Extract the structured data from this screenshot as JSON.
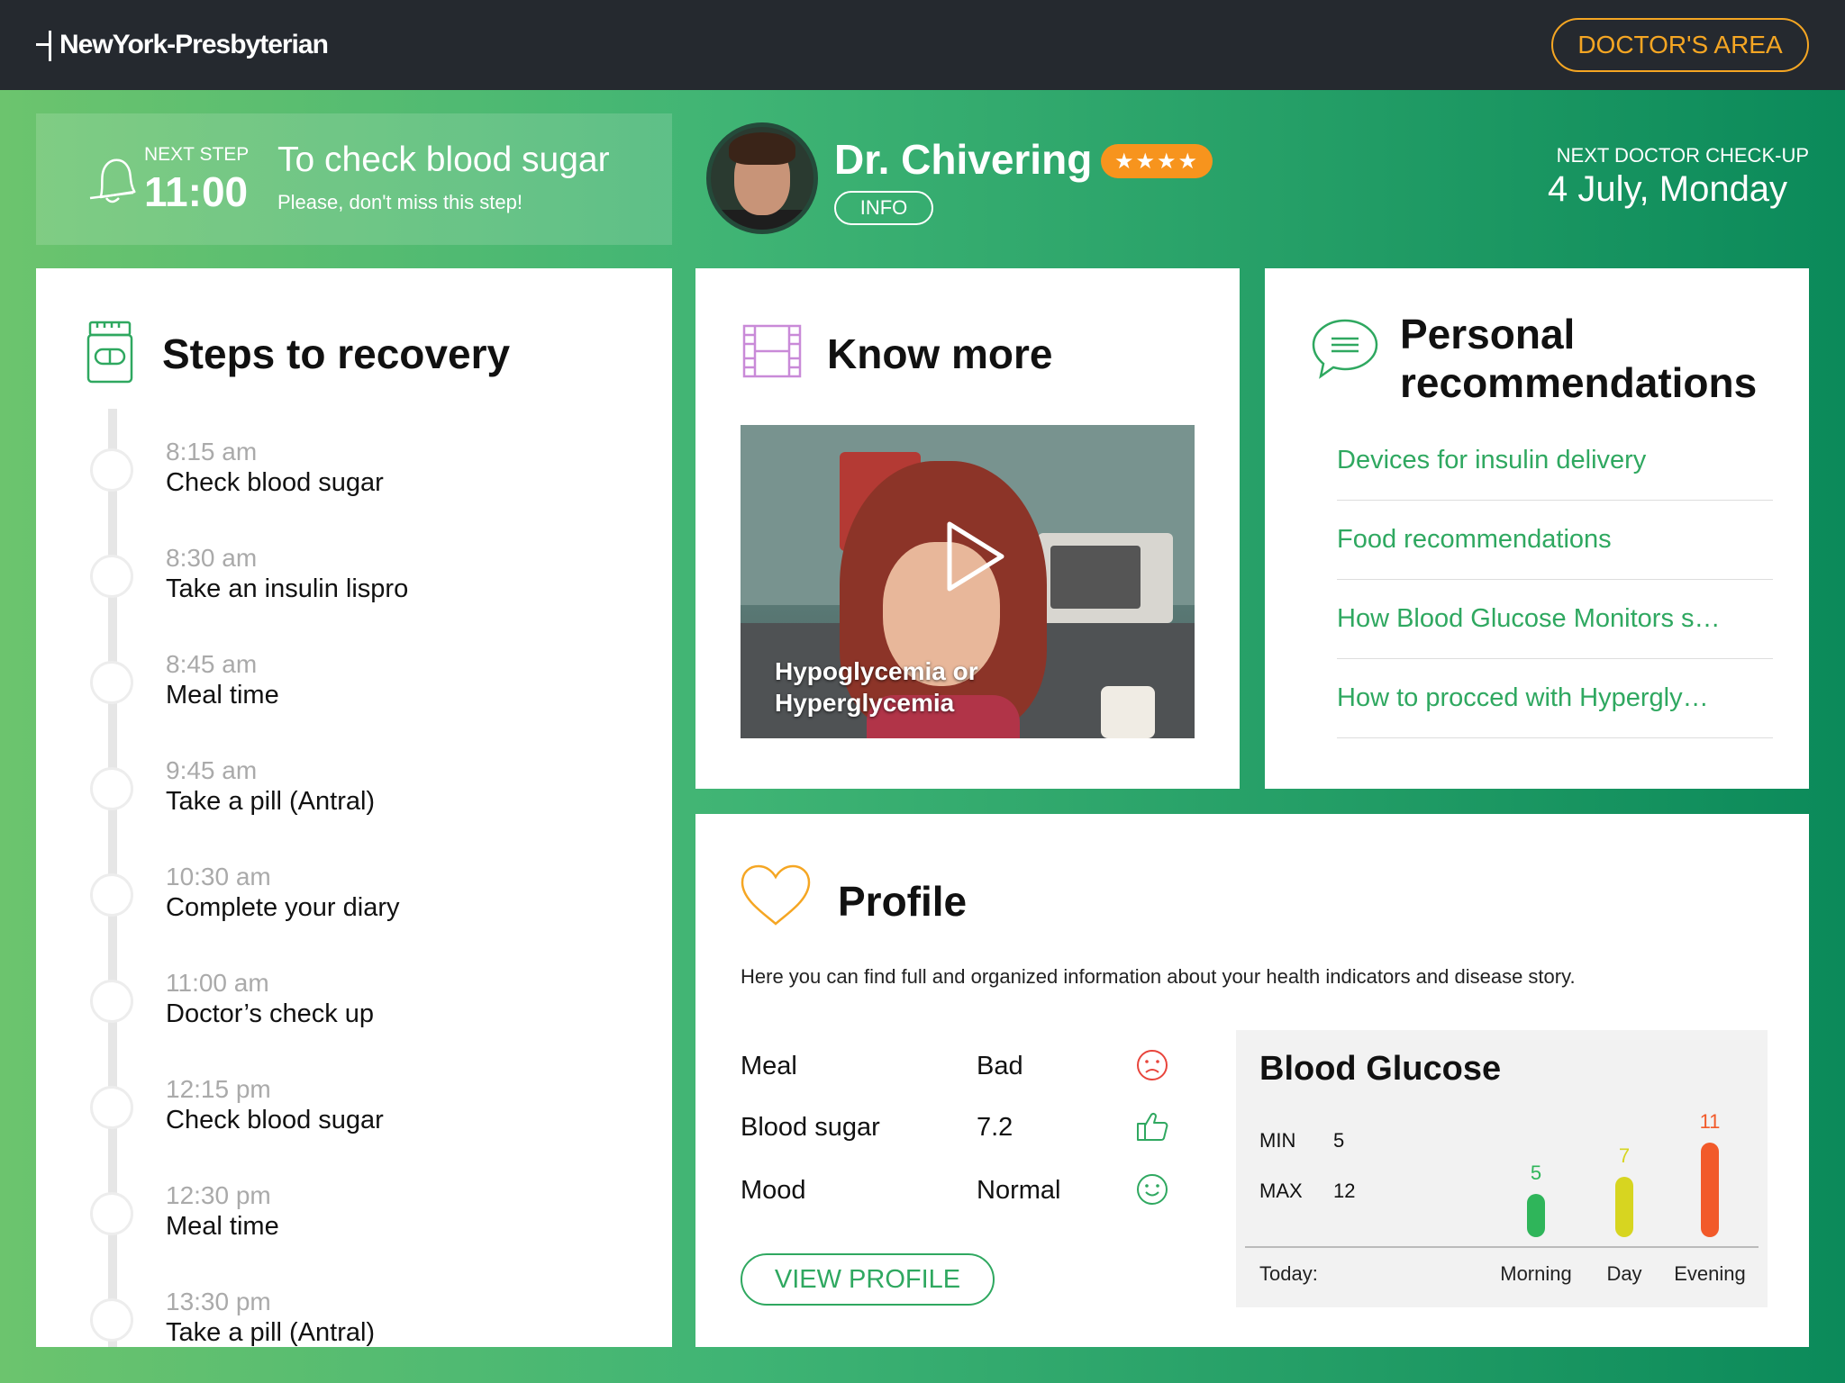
{
  "header": {
    "logo": "NewYork-Presbyterian",
    "doctors_area": "DOCTOR'S AREA"
  },
  "next_step": {
    "label": "NEXT STEP",
    "time": "11:00",
    "title": "To check blood sugar",
    "subtitle": "Please, don't miss this step!"
  },
  "doctor": {
    "name": "Dr. Chivering",
    "rating_stars": "★★★★",
    "rating": 4,
    "info_label": "INFO"
  },
  "checkup": {
    "label": "NEXT DOCTOR CHECK-UP",
    "date": "4 July, Monday"
  },
  "steps": {
    "title": "Steps to recovery",
    "items": [
      {
        "time": "8:15 am",
        "text": "Check blood sugar"
      },
      {
        "time": "8:30 am",
        "text": "Take an insulin lispro"
      },
      {
        "time": "8:45 am",
        "text": "Meal time"
      },
      {
        "time": "9:45 am",
        "text": "Take a pill (Antral)"
      },
      {
        "time": "10:30 am",
        "text": "Complete your diary"
      },
      {
        "time": "11:00 am",
        "text": "Doctor’s check up"
      },
      {
        "time": "12:15 pm",
        "text": "Check blood sugar"
      },
      {
        "time": "12:30 pm",
        "text": "Meal time"
      },
      {
        "time": "13:30 pm",
        "text": "Take a pill (Antral)"
      }
    ]
  },
  "know_more": {
    "title": "Know more",
    "video_title": "Hypoglycemia or Hyperglycemia"
  },
  "recommendations": {
    "title": "Personal recommendations",
    "items": [
      "Devices for insulin delivery",
      "Food recommendations",
      "How Blood Glucose Monitors s…",
      "How to procced with Hypergly…"
    ]
  },
  "profile": {
    "title": "Profile",
    "description": "Here you can find full and organized information about your health indicators and disease story.",
    "rows": [
      {
        "label": "Meal",
        "value": "Bad",
        "icon": "sad-face-icon"
      },
      {
        "label": "Blood sugar",
        "value": "7.2",
        "icon": "thumbs-up-icon"
      },
      {
        "label": "Mood",
        "value": "Normal",
        "icon": "smile-face-icon"
      }
    ],
    "view_button": "VIEW PROFILE"
  },
  "blood_glucose": {
    "title": "Blood Glucose",
    "min_label": "MIN",
    "min_value": "5",
    "max_label": "MAX",
    "max_value": "12",
    "today_label": "Today:",
    "bars": [
      {
        "label": "Morning",
        "value": 5,
        "value_text": "5",
        "color": "#2fb55a"
      },
      {
        "label": "Day",
        "value": 7,
        "value_text": "7",
        "color": "#d7d520"
      },
      {
        "label": "Evening",
        "value": 11,
        "value_text": "11",
        "color": "#f25a2a"
      }
    ]
  },
  "colors": {
    "accent_green": "#2fa860",
    "accent_orange": "#f5a623",
    "topbar": "#25292f"
  }
}
